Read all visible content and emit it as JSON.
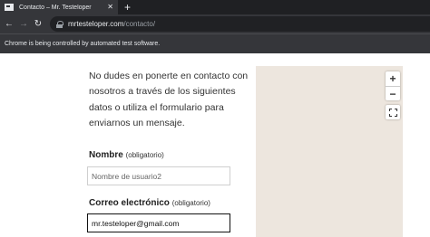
{
  "browser": {
    "tab_title": "Contacto – Mr. Testeloper",
    "tab_close_glyph": "✕",
    "new_tab_glyph": "+",
    "back_glyph": "←",
    "forward_glyph": "→",
    "reload_glyph": "↻",
    "url_host": "mrtesteloper.com",
    "url_path": "/contacto/",
    "infobar_text": "Chrome is being controlled by automated test software."
  },
  "page": {
    "intro_text": "No dudes en ponerte en contacto con nosotros a través de los siguientes datos o utiliza el formulario para enviarnos un mensaje.",
    "name_label": "Nombre",
    "name_required": "(obligatorio)",
    "name_value": "Nombre de usuario2",
    "email_label": "Correo electrónico",
    "email_required": "(obligatorio)",
    "email_value": "mr.testeloper@gmail.com"
  },
  "map": {
    "zoom_in": "+",
    "zoom_out": "−",
    "background_color": "#ede6de"
  },
  "icons": {
    "tab_favicon": "window-icon",
    "lock": "lock-icon",
    "fullscreen": "fullscreen-icon"
  }
}
